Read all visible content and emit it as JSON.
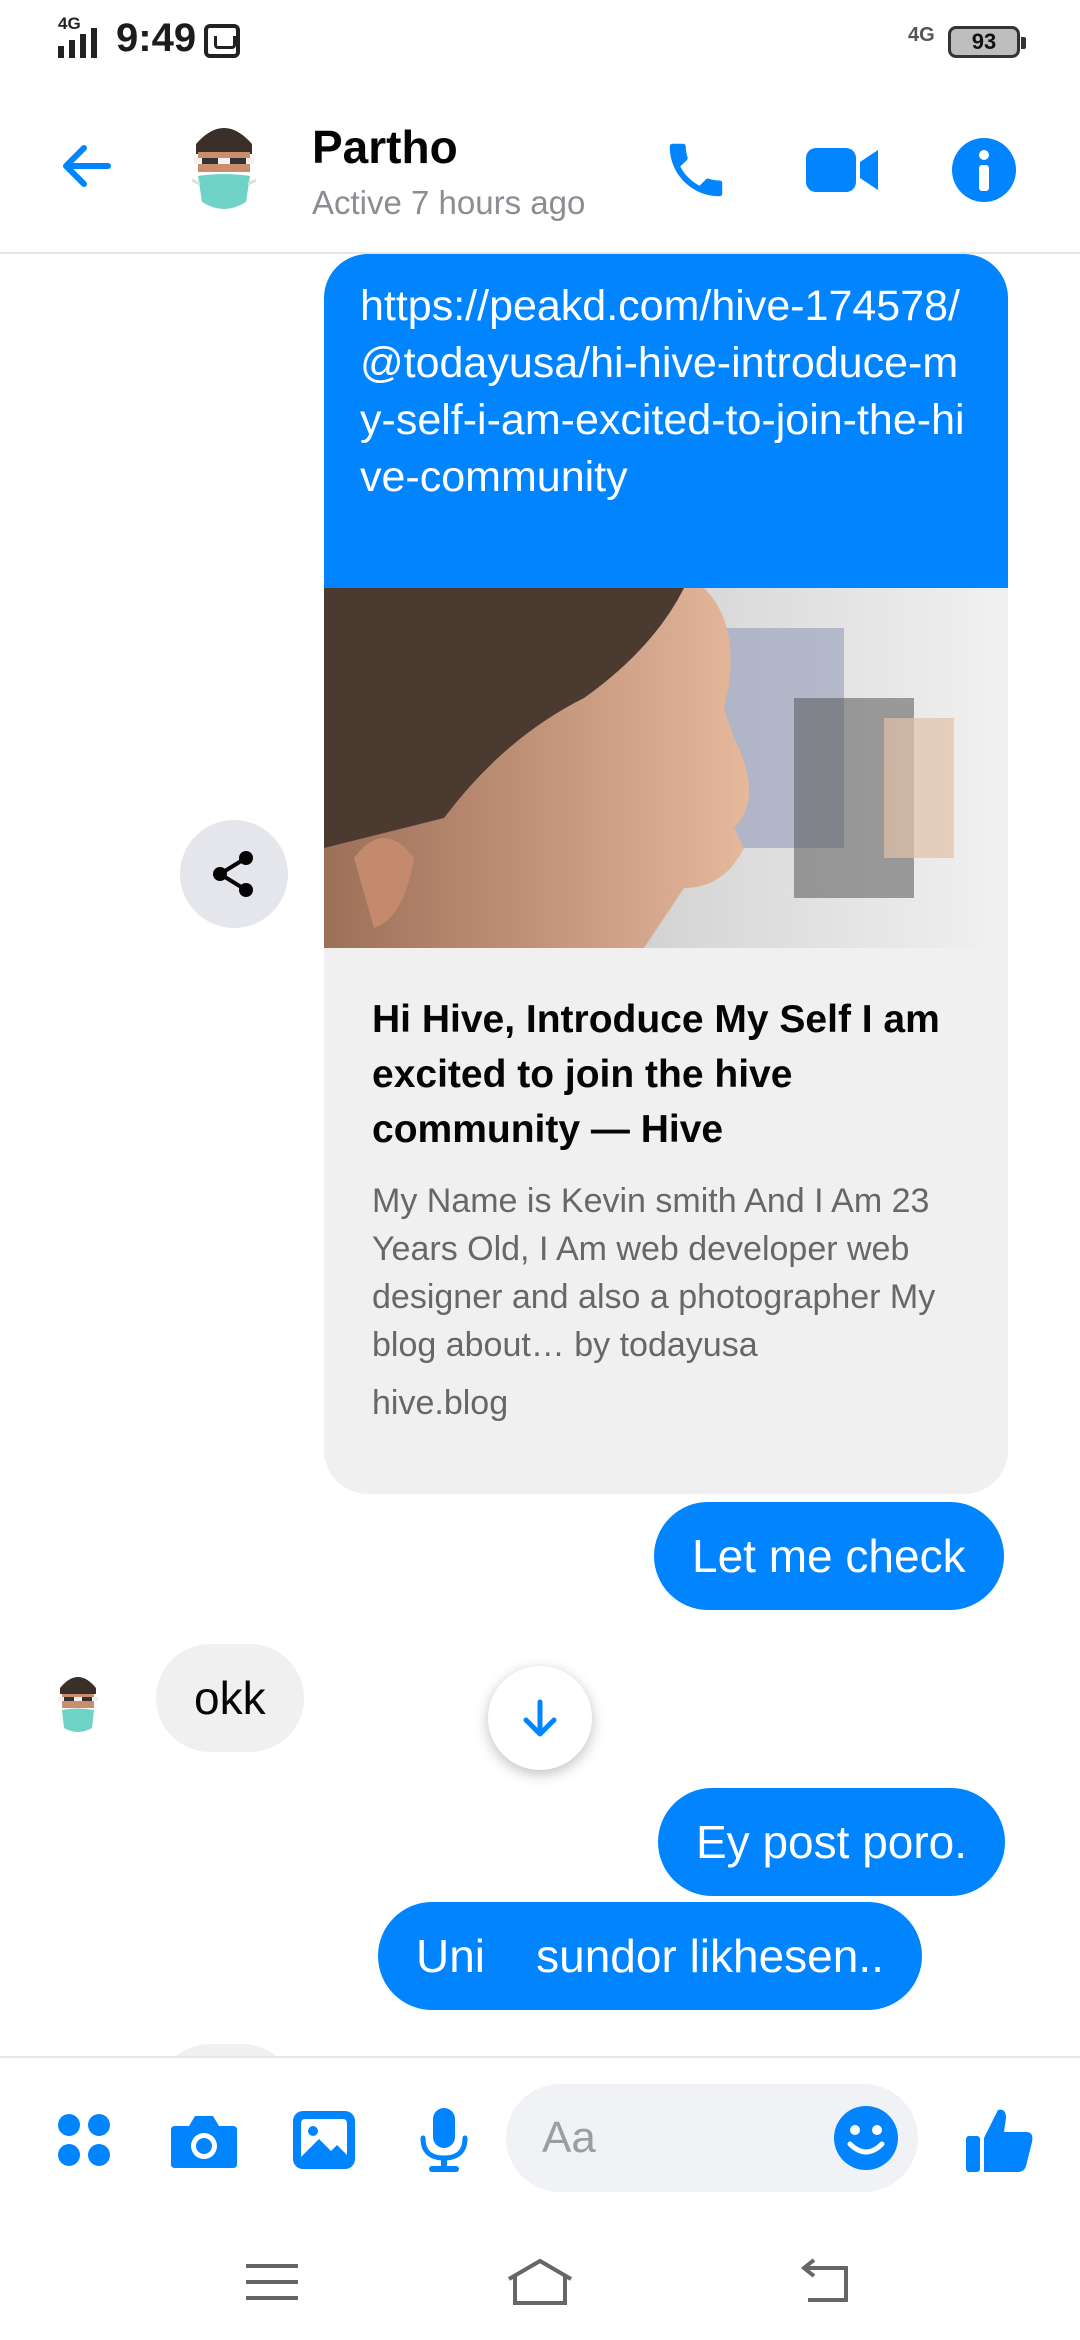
{
  "status_bar": {
    "network_left": "4G",
    "time": "9:49",
    "network_right": "4G",
    "battery": "93"
  },
  "header": {
    "contact_name": "Partho",
    "contact_status": "Active 7 hours ago"
  },
  "conversation": {
    "link_preview": {
      "url": "https://peakd.com/hive-174578/@todayusa/hi-hive-introduce-my-self-i-am-excited-to-join-the-hive-community",
      "title": "Hi Hive, Introduce My Self I am excited to join the hive community — Hive",
      "description": "My Name is Kevin smith And I Am 23 Years Old, I Am web developer web designer and also a photographer My blog about… by todayusa",
      "domain": "hive.blog"
    },
    "messages": [
      {
        "direction": "outgoing",
        "text": "Let me check"
      },
      {
        "direction": "incoming",
        "text": "okk"
      },
      {
        "direction": "outgoing",
        "text": "Ey post poro."
      },
      {
        "direction": "outgoing",
        "text": "Uni    sundor likhesen.."
      }
    ]
  },
  "composer": {
    "placeholder": "Aa"
  },
  "colors": {
    "accent": "#0084ff",
    "incoming_bubble": "#f0f0f0",
    "secondary_text": "#65676b"
  },
  "icons": {
    "header": [
      "back-arrow-icon",
      "phone-icon",
      "video-camera-icon",
      "info-icon"
    ],
    "composer": [
      "apps-icon",
      "camera-icon",
      "gallery-icon",
      "microphone-icon",
      "emoji-icon",
      "thumbs-up-icon"
    ],
    "navbar": [
      "menu-icon",
      "home-icon",
      "back-icon"
    ]
  }
}
